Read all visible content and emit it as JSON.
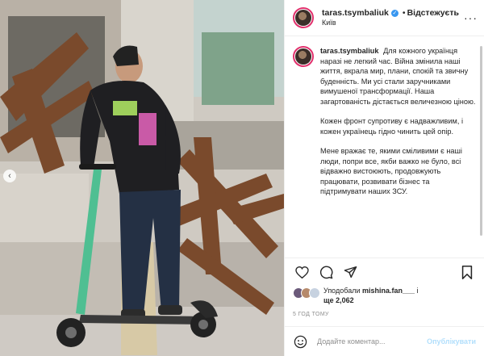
{
  "account": {
    "username": "taras.tsymbaliuk",
    "follow_label": "Відстежуєть",
    "separator": "•",
    "location": "Київ"
  },
  "caption": {
    "username": "taras.tsymbaliuk",
    "paragraphs": [
      "Для кожного українця наразі не легкий час. Війна змінила наші життя, вкрала мир, плани, спокій та звичну буденність. Ми усі стали заручниками вимушеної трансформації. Наша загартованість дістається величезною ціною.",
      "Кожен фронт супротиву є надважливим, і кожен українець гідно чинить цей опір.",
      "Мене вражає те, якими сміливими є наші люди, попри все, якби важко не було, всі відважно вистоюють, продовжують працювати, розвивати бізнес та підтримувати наших ЗСУ."
    ]
  },
  "icons": {
    "like": "heart-icon",
    "comment": "comment-bubble-icon",
    "share": "paper-plane-icon",
    "save": "bookmark-icon",
    "emoji": "smiley-icon",
    "more": "ellipsis-icon",
    "verified": "verified-badge-icon"
  },
  "likes": {
    "prefix": "Уподобали",
    "user": "mishina.fan___",
    "suffix": "і",
    "more": "ще 2,062"
  },
  "timestamp": "5 ГОД ТОМУ",
  "comment": {
    "placeholder": "Додайте коментар...",
    "publish_label": "Опублікувати"
  },
  "colors": {
    "verified": "#3897f0",
    "avatar_ring": "#e1306c",
    "publish_disabled": "#b2dffc"
  }
}
